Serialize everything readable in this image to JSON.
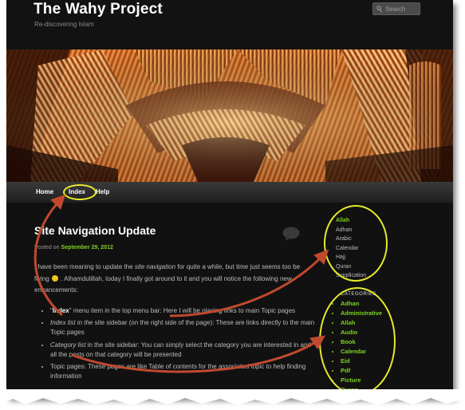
{
  "site": {
    "title": "The Wahy Project",
    "description": "Re-discovering Islam",
    "search_placeholder": "Search"
  },
  "nav": {
    "items": [
      {
        "label": "Home"
      },
      {
        "label": "Index"
      },
      {
        "label": "Help"
      }
    ]
  },
  "post": {
    "title": "Site Navigation Update",
    "posted_prefix": "Posted on",
    "posted_date": "September 29, 2012",
    "intro": {
      "part1": "I have been meaning to update the ",
      "em1": "site navigation",
      "part2": " for quite a while, but time just seems too be flying",
      "part3": " . Alhamdulillah, today I finally got around to it and you will notice the following new enhancements:"
    },
    "bullets": [
      {
        "lead_quote_open": "\"",
        "lead": "Index",
        "lead_quote_close": "\"",
        "rest": " menu item in the top menu bar: Here I will be placing links to main Topic pages"
      },
      {
        "lead": "Index list in the",
        "rest": " site sidebar (on the right side of the page): These are links directly to the main Topic pages"
      },
      {
        "lead": "Category list",
        "rest": " in the site sidebar: You can simply select the category you are interested in and all the posts on that category will be presented"
      },
      {
        "lead": "Topic pages",
        "rest": ": These pages are like Table of contents for the associated topic to help finding information"
      }
    ]
  },
  "sidebar": {
    "index_list": [
      "Allah",
      "Adhan",
      "Arabic",
      "Calendar",
      "Hajj",
      "Quran",
      "Supplication"
    ],
    "categories_heading": "CATEGORIES",
    "categories": [
      "Adhan",
      "Administrative",
      "Allah",
      "Audio",
      "Book",
      "Calendar",
      "Eid",
      "Pdf",
      "Picture",
      "Quran"
    ]
  },
  "colors": {
    "accent_green": "#7ed321",
    "highlight_yellow": "#e6ea2a",
    "arrow_red": "#c0492e",
    "background": "#111111"
  }
}
